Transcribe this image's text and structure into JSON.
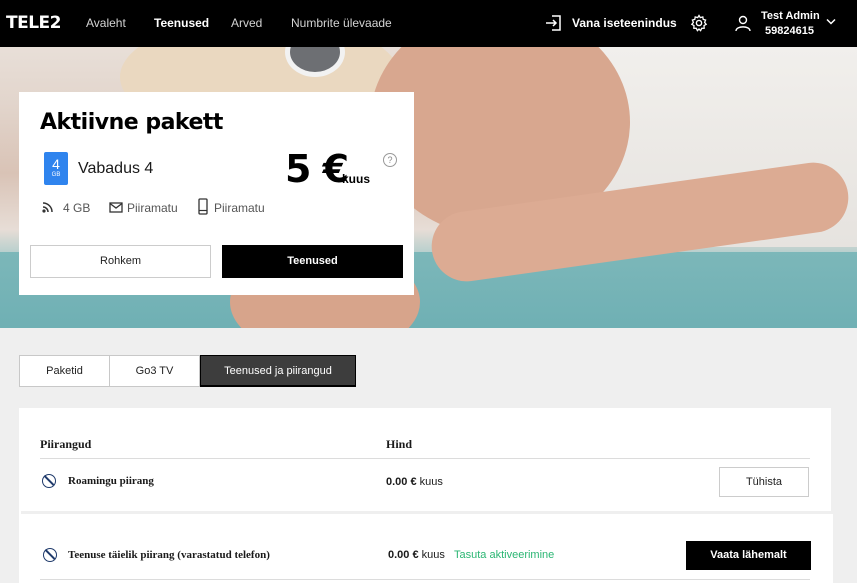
{
  "brand": {
    "logo": "TELE2"
  },
  "nav": {
    "items": [
      "Avaleht",
      "Teenused",
      "Arved",
      "Numbrite ülevaade"
    ],
    "active": "Teenused",
    "old_selfservice": "Vana iseteenindus",
    "user_name": "Test Admin",
    "user_number": "59824615"
  },
  "package": {
    "title": "Aktiivne pakett",
    "sim_number": "4",
    "sim_unit": "GB",
    "name": "Vabadus 4",
    "price": "5 €",
    "price_unit": "kuus",
    "help": "?",
    "features": {
      "data": "4 GB",
      "sms": "Piiramatu",
      "calls": "Piiramatu"
    },
    "btn_more": "Rohkem",
    "btn_services": "Teenused"
  },
  "tabs": [
    "Paketid",
    "Go3 TV",
    "Teenused ja piirangud"
  ],
  "restrictions": {
    "col_name": "Piirangud",
    "col_price": "Hind",
    "rows": [
      {
        "label": "Roamingu piirang",
        "price": "0.00 €",
        "period": "kuus",
        "note": "",
        "action": "Tühista"
      },
      {
        "label": "Teenuse täielik piirang (varastatud telefon)",
        "price": "0.00 €",
        "period": "kuus",
        "note": "Tasuta aktiveerimine",
        "action": "Vaata lähemalt"
      }
    ]
  },
  "colors": {
    "accent": "#2f84ee",
    "free": "#2bb673",
    "nav_bg": "#000000"
  }
}
